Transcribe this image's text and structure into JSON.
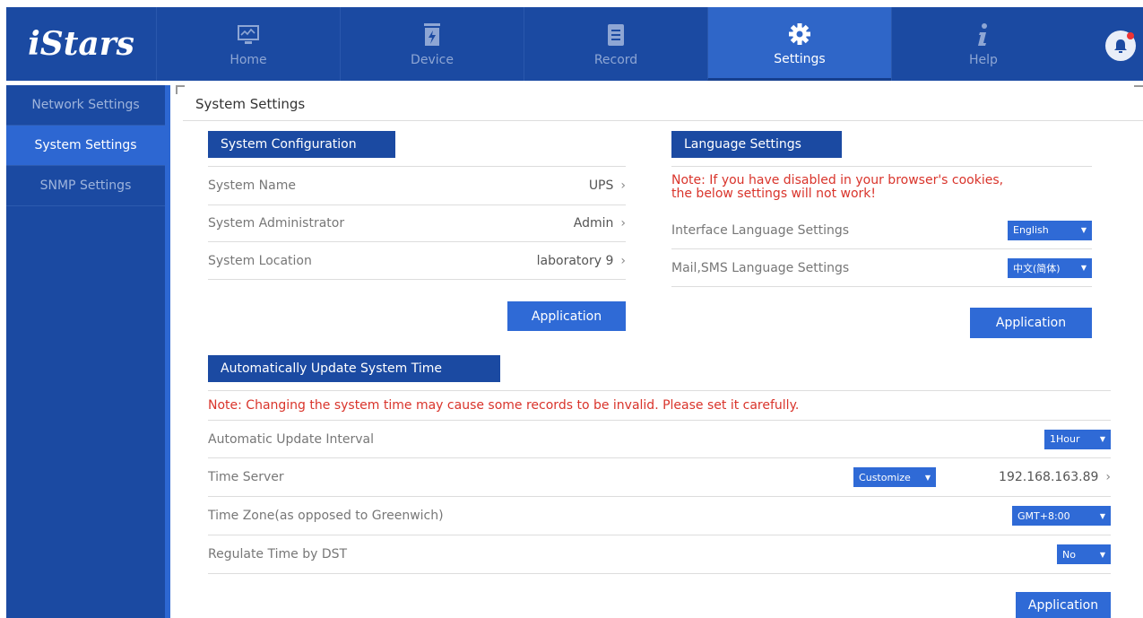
{
  "app": {
    "logo": "iStars"
  },
  "nav": {
    "items": [
      {
        "label": "Home",
        "icon": "monitor-icon"
      },
      {
        "label": "Device",
        "icon": "battery-icon"
      },
      {
        "label": "Record",
        "icon": "document-icon"
      },
      {
        "label": "Settings",
        "icon": "gear-icon"
      },
      {
        "label": "Help",
        "icon": "info-icon"
      }
    ],
    "active": "Settings"
  },
  "sidebar": {
    "items": [
      {
        "label": "Network Settings"
      },
      {
        "label": "System Settings"
      },
      {
        "label": "SNMP Settings"
      }
    ],
    "active": "System Settings"
  },
  "page": {
    "title": "System Settings"
  },
  "system_config": {
    "header": "System Configuration",
    "rows": [
      {
        "label": "System Name",
        "value": "UPS"
      },
      {
        "label": "System Administrator",
        "value": "Admin"
      },
      {
        "label": "System Location",
        "value": "laboratory 9"
      }
    ],
    "apply": "Application"
  },
  "language": {
    "header": "Language Settings",
    "note_line1": "Note: If you have disabled in your browser's cookies,",
    "note_line2": "the below settings will not work!",
    "interface_label": "Interface Language Settings",
    "interface_value": "English",
    "mail_label": "Mail,SMS Language Settings",
    "mail_value": "中文(简体)",
    "apply": "Application"
  },
  "time": {
    "header": "Automatically Update System Time",
    "note": "Note: Changing the system time may cause some records to be invalid. Please set it carefully.",
    "interval_label": "Automatic Update Interval",
    "interval_value": "1Hour",
    "server_label": "Time Server",
    "server_mode": "Customize",
    "server_value": "192.168.163.89",
    "zone_label": "Time Zone(as opposed to Greenwich)",
    "zone_value": "GMT+8:00",
    "dst_label": "Regulate Time by DST",
    "dst_value": "No",
    "apply": "Application"
  },
  "colors": {
    "nav_bg": "#1b4aa2",
    "active": "#2f66c8",
    "button": "#2f6ad6",
    "warning": "#d9342b"
  }
}
